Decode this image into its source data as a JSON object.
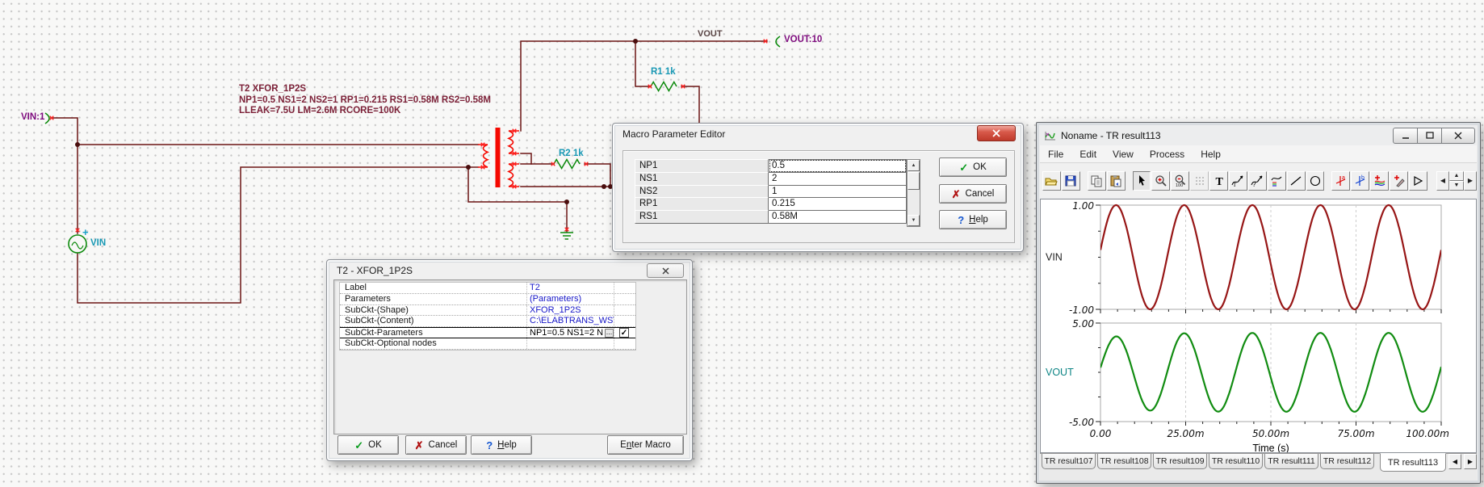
{
  "schematic": {
    "net_labels": {
      "vin_terminal": "VIN:1",
      "vout_terminal": "VOUT:10",
      "vout_net": "VOUT"
    },
    "components": {
      "r1": "R1 1k",
      "r2": "R2 1k",
      "source_label": "VIN",
      "source_plus": "+"
    },
    "t2_annotation": {
      "line1": "T2 XFOR_1P2S",
      "line2": "NP1=0.5 NS1=2 NS2=1 RP1=0.215 RS1=0.58M RS2=0.58M",
      "line3": "LLEAK=7.5U LM=2.6M RCORE=100K"
    },
    "colors": {
      "wire": "#6b1414",
      "selected_part": "#f50800",
      "part_green": "#0c8a0c",
      "label_teal": "#1898b4",
      "net_purple": "#7e0b7e",
      "annotation": "#7c2138"
    }
  },
  "macro_editor": {
    "title": "Macro Parameter Editor",
    "rows": [
      {
        "name": "NP1",
        "value": "0.5"
      },
      {
        "name": "NS1",
        "value": "2"
      },
      {
        "name": "NS2",
        "value": "1"
      },
      {
        "name": "RP1",
        "value": "0.215"
      },
      {
        "name": "RS1",
        "value": "0.58M"
      }
    ],
    "buttons": {
      "ok": "OK",
      "cancel": "Cancel",
      "help": {
        "u": "H",
        "post": "elp"
      }
    }
  },
  "t2_dialog": {
    "title": "T2 - XFOR_1P2S",
    "rows": [
      {
        "label": "Label",
        "value": "T2"
      },
      {
        "label": "Parameters",
        "value": "(Parameters)"
      },
      {
        "label": "SubCkt-(Shape)",
        "value": "XFOR_1P2S"
      },
      {
        "label": "SubCkt-(Content)",
        "value": "C:\\ELABTRANS_WS\\"
      },
      {
        "label": "SubCkt-Parameters",
        "value": "NP1=0.5 NS1=2 N"
      },
      {
        "label": "SubCkt-Optional nodes",
        "value": ""
      }
    ],
    "buttons": {
      "ok": "OK",
      "cancel": "Cancel",
      "help": {
        "u": "H",
        "post": "elp"
      },
      "enter_macro": {
        "pre": "E",
        "u": "n",
        "post": "ter Macro"
      }
    }
  },
  "tr_window": {
    "title": "Noname - TR result113",
    "menu": [
      "File",
      "Edit",
      "View",
      "Process",
      "Help"
    ],
    "tabs": [
      "TR result107",
      "TR result108",
      "TR result109",
      "TR result110",
      "TR result111",
      "TR result112",
      "TR result113"
    ],
    "active_tab": "TR result113"
  },
  "icons": {
    "check": "✓",
    "cross": "✗",
    "question": "?",
    "ellipsis": "...",
    "left": "◀",
    "right": "▶",
    "up": "▲",
    "down": "▼",
    "play": "▷",
    "circle": "○",
    "text_tool": "T",
    "cursor_a": "a",
    "cursor_b": "b",
    "zoom_100": "100"
  },
  "chart_data": {
    "type": "line",
    "x_axis": {
      "label": "Time (s)",
      "min": 0,
      "max": 0.1,
      "major_tick_labels": [
        "0.00",
        "25.00m",
        "50.00m",
        "75.00m",
        "100.00m"
      ],
      "minor_tick_interval": 0.005,
      "gridlines": "dashed-vertical"
    },
    "subplots": [
      {
        "name": "VIN",
        "color": "#971616",
        "label_color": "#1c1c1c",
        "ylim": [
          -1,
          1
        ],
        "ytick_labels": [
          "1.00",
          "-1.00"
        ],
        "signal": {
          "shape": "sine",
          "amplitude": 1.0,
          "frequency_hz": 50,
          "phase_deg": 8
        }
      },
      {
        "name": "VOUT",
        "color": "#118c11",
        "label_color": "#0e8585",
        "ylim": [
          -5,
          5
        ],
        "ytick_labels": [
          "5.00",
          "-5.00"
        ],
        "signal": {
          "shape": "sine",
          "amplitude": 4.0,
          "first_peak": 3.4,
          "settle_tau_s": 0.009,
          "frequency_hz": 50,
          "phase_deg": 8
        }
      }
    ]
  }
}
